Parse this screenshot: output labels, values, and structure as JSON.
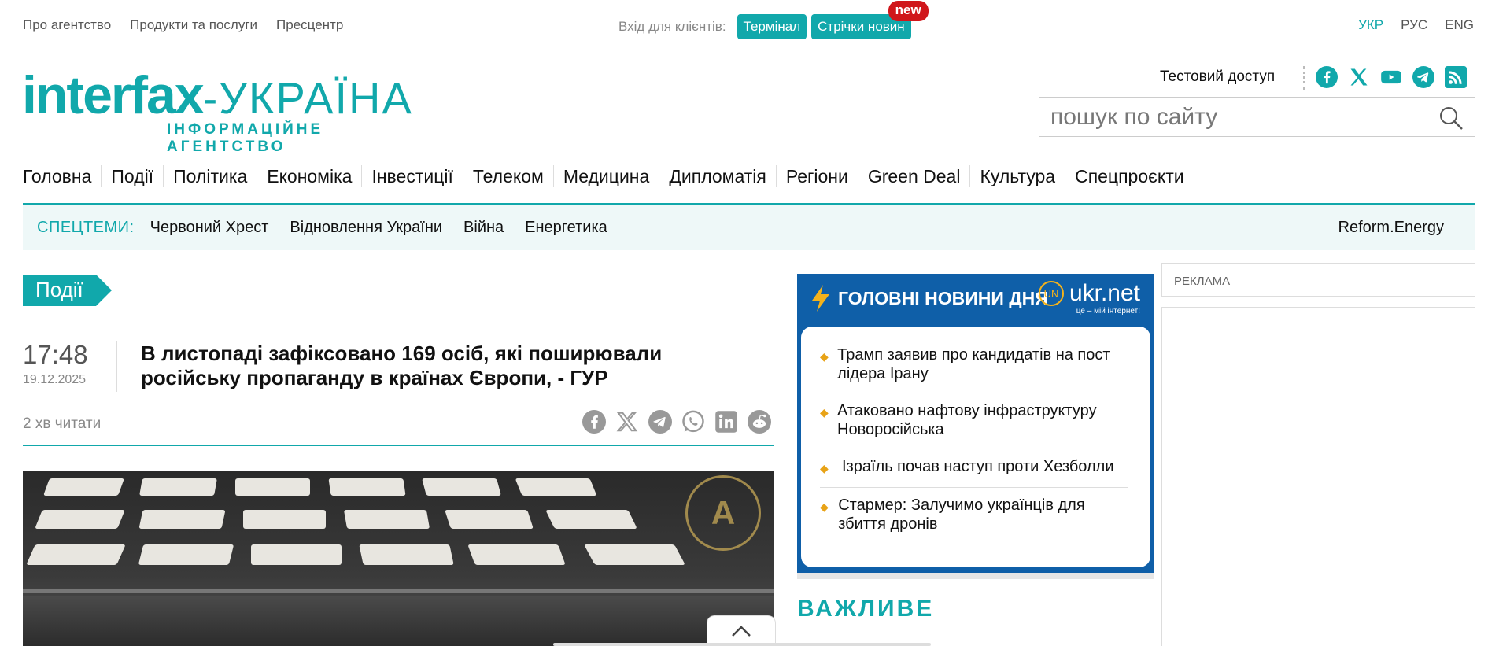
{
  "top_links": [
    "Про агентство",
    "Продукти та послуги",
    "Пресцентр"
  ],
  "clients": {
    "label": "Вхід для клієнтів:",
    "terminal": "Термінал",
    "news_feeds": "Стрічки новин",
    "new_badge": "new"
  },
  "languages": [
    "УКР",
    "РУС",
    "ENG"
  ],
  "logo": {
    "word": "interfax",
    "country": "-УКРАЇНА",
    "subtitle": "ІНФОРМАЦІЙНЕ АГЕНТСТВО"
  },
  "header": {
    "test_access": "Тестовий доступ",
    "search_placeholder": "пошук по сайту"
  },
  "socials": [
    "facebook-icon",
    "x-icon",
    "youtube-icon",
    "telegram-icon",
    "rss-icon"
  ],
  "main_nav": [
    "Головна",
    "Події",
    "Політика",
    "Економіка",
    "Інвестиції",
    "Телеком",
    "Медицина",
    "Дипломатія",
    "Регіони",
    "Green Deal",
    "Культура",
    "Спецпроєкти"
  ],
  "special_topics": {
    "label": "СПЕЦТЕМИ:",
    "items": [
      "Червоний Хрест",
      "Відновлення України",
      "Війна",
      "Енергетика"
    ],
    "right": "Reform.Energy"
  },
  "article": {
    "category": "Події",
    "time": "17:48",
    "date": "19.12.2025",
    "headline": "В листопаді зафіксовано 169 осіб, які поширювали російську пропаганду в країнах Європи, - ГУР",
    "read_time": "2 хв читати",
    "share_icons": [
      "facebook-icon",
      "x-icon",
      "telegram-icon",
      "whatsapp-icon",
      "linkedin-icon",
      "reddit-icon"
    ]
  },
  "top_news": {
    "title": "ГОЛОВНІ НОВИНИ ДНЯ",
    "partner": "ukr.net",
    "partner_slogan": "це – мій інтернет!",
    "items": [
      "Трамп заявив про кандидатів на пост лідера Ірану",
      "Атаковано нафтову інфраструктуру Новоросійська",
      "Ізраїль почав наступ проти Хезболли",
      "Стармер: Залучимо українців для збиття дронів"
    ]
  },
  "important_heading": "ВАЖЛИВЕ",
  "ad_label": "РЕКЛАМА",
  "colors": {
    "accent": "#11a8ab",
    "top_news_bg": "#0f5fa8",
    "badge": "#d0161b",
    "bullet": "#e8a317"
  }
}
